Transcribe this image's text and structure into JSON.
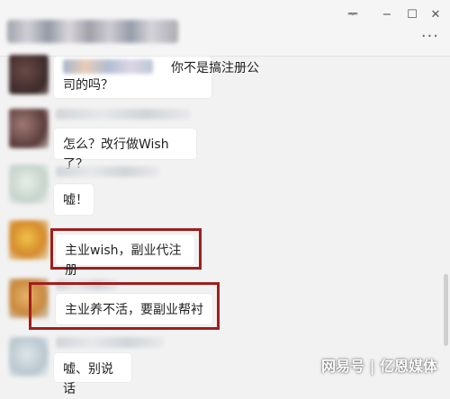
{
  "window_controls": {
    "pin": "ᆓ",
    "minimize": "−",
    "maximize": "☐",
    "close": "✕",
    "more": "···"
  },
  "messages": [
    {
      "text_line1": "你不是搞注册公",
      "text_line2": "司的吗？"
    },
    {
      "text": "怎么？改行做Wish了？"
    },
    {
      "text": "嘘！"
    },
    {
      "text": "主业wish，副业代注册"
    },
    {
      "text": "主业养不活，要副业帮衬"
    },
    {
      "text": "嘘、别说话"
    }
  ],
  "watermark": "网易号 | 亿恩媒体",
  "colors": {
    "background": "#f2f2f2",
    "bubble": "#ffffff",
    "highlight_border": "#a11d1d"
  }
}
